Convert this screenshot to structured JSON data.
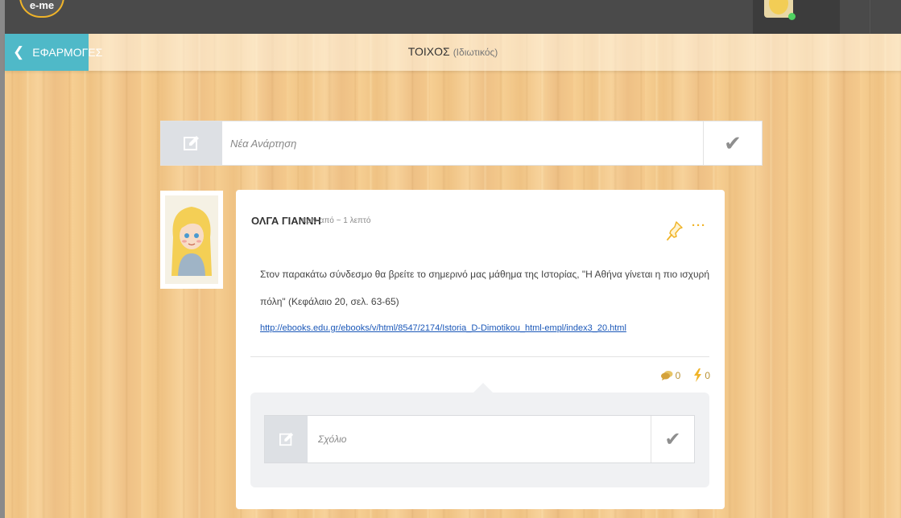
{
  "topbar": {
    "logo_text": "e-me",
    "user_avatar_icon": "user-avatar",
    "status_color": "#4fd161"
  },
  "header": {
    "back_label": "ΕΦΑΡΜΟΓΕΣ",
    "back_icon": "chevron-left-icon",
    "title": "ΤΟΙΧΟΣ",
    "subtitle": "(Ιδιωτικός)",
    "accent_color": "#4fb9c8"
  },
  "new_post": {
    "placeholder": "Νέα Ανάρτηση",
    "edit_icon": "edit-icon",
    "submit_icon": "checkmark-icon"
  },
  "post": {
    "author": "ΟΛΓΑ ΓΙΑΝΝΗ",
    "time": "πριν από ~ 1 λεπτό",
    "text": "Στον παρακάτω σύνδεσμο θα βρείτε το σημερινό μας μάθημα της Ιστορίας, \"Η Αθήνα γίνεται η πιο ισχυρή πόλη\" (Κεφάλαιο 20, σελ. 63-65)",
    "link": "http://ebooks.edu.gr/ebooks/v/html/8547/2174/Istoria_D-Dimotikou_html-empl/index3_20.html",
    "pin_icon": "pin-icon",
    "more_icon": "more-icon",
    "comments_count": "0",
    "likes_count": "0",
    "accent_color": "#f0b429"
  },
  "comment": {
    "placeholder": "Σχόλιο",
    "edit_icon": "edit-icon",
    "submit_icon": "checkmark-icon"
  }
}
